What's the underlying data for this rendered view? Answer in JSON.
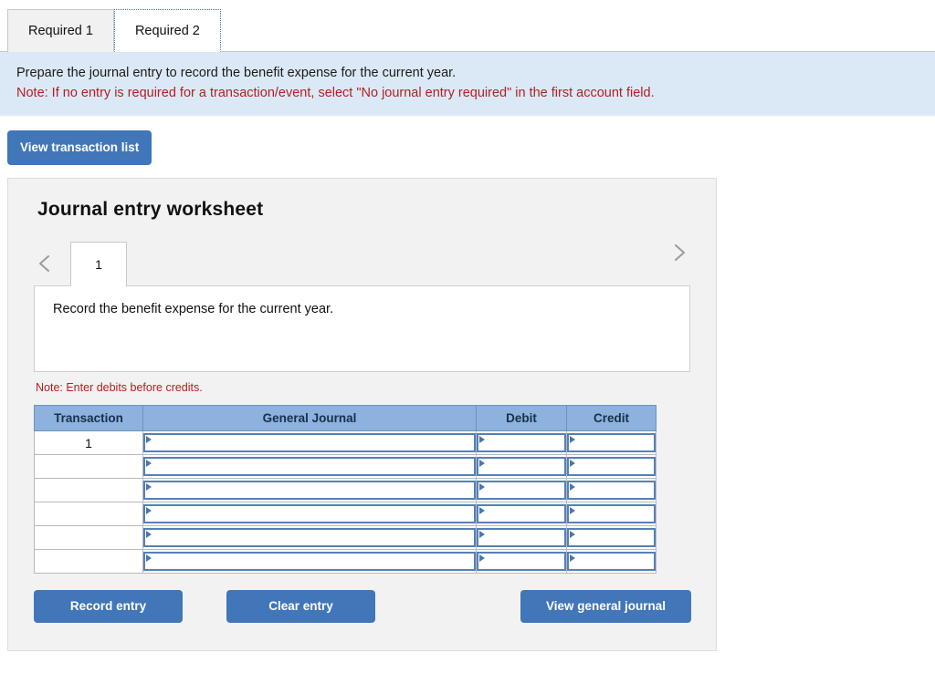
{
  "tabs": [
    {
      "label": "Required 1",
      "active": false
    },
    {
      "label": "Required 2",
      "active": true
    }
  ],
  "instructions": {
    "line1": "Prepare the journal entry to record the benefit expense for the current year.",
    "line2": "Note: If no entry is required for a transaction/event, select \"No journal entry required\" in the first account field.",
    "note_color": "#b32020",
    "background": "#dbe9f6"
  },
  "toolbar": {
    "view_transaction_list_label": "View transaction list"
  },
  "worksheet": {
    "title": "Journal entry worksheet",
    "prev_icon": "chevron-left-icon",
    "next_icon": "chevron-right-icon",
    "entry_tabs": [
      {
        "label": "1",
        "active": true
      }
    ],
    "description": "Record the benefit expense for the current year.",
    "note": "Note: Enter debits before credits.",
    "table": {
      "headers": [
        "Transaction",
        "General Journal",
        "Debit",
        "Credit"
      ],
      "header_color": "#8cb2dd",
      "rows": [
        {
          "transaction": "1",
          "general_journal": "",
          "debit": "",
          "credit": ""
        },
        {
          "transaction": "",
          "general_journal": "",
          "debit": "",
          "credit": ""
        },
        {
          "transaction": "",
          "general_journal": "",
          "debit": "",
          "credit": ""
        },
        {
          "transaction": "",
          "general_journal": "",
          "debit": "",
          "credit": ""
        },
        {
          "transaction": "",
          "general_journal": "",
          "debit": "",
          "credit": ""
        },
        {
          "transaction": "",
          "general_journal": "",
          "debit": "",
          "credit": ""
        }
      ]
    },
    "actions": {
      "record_entry_label": "Record entry",
      "clear_entry_label": "Clear entry",
      "view_general_journal_label": "View general journal",
      "button_color": "#4176b8"
    }
  }
}
